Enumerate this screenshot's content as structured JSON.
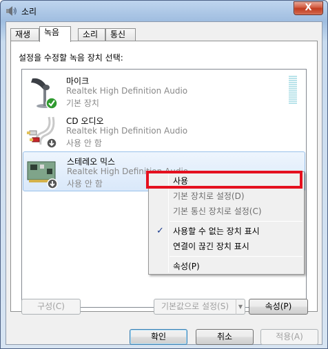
{
  "window": {
    "title": "소리",
    "close_label": "X"
  },
  "tabs": [
    {
      "label": "재생",
      "active": false
    },
    {
      "label": "녹음",
      "active": true
    },
    {
      "label": "소리",
      "active": false
    },
    {
      "label": "통신",
      "active": false
    }
  ],
  "panel": {
    "instruction": "설정을 수정할 녹음 장치 선택:"
  },
  "devices": [
    {
      "name": "마이크",
      "driver": "Realtek High Definition Audio",
      "status": "기본 장치",
      "icon": "microphone-icon",
      "badge": "default-check-badge"
    },
    {
      "name": "CD 오디오",
      "driver": "Realtek High Definition Audio",
      "status": "사용 안 함",
      "icon": "cd-audio-cable-icon",
      "badge": "disabled-arrow-badge"
    },
    {
      "name": "스테레오 믹스",
      "driver": "Realtek High Definition Audio",
      "status": "사용 안 함",
      "icon": "sound-card-icon",
      "badge": "disabled-arrow-badge"
    }
  ],
  "context_menu": {
    "items": [
      {
        "label": "사용",
        "enabled": true
      },
      {
        "label": "기본 장치로 설정(D)",
        "enabled": false
      },
      {
        "label": "기본 통신 장치로 설정(C)",
        "enabled": false
      },
      {
        "label": "사용할 수 없는 장치 표시",
        "enabled": true,
        "checked": true
      },
      {
        "label": "연결이 끊긴 장치 표시",
        "enabled": true
      },
      {
        "label": "속성(P)",
        "enabled": true
      }
    ],
    "check_glyph": "✓",
    "highlight_color": "#e5101f"
  },
  "panel_buttons": {
    "configure": "구성(C)",
    "set_default": "기본값으로 설정(S)",
    "properties": "속성(P)"
  },
  "dialog_buttons": {
    "ok": "확인",
    "cancel": "취소",
    "apply": "적용(A)"
  }
}
